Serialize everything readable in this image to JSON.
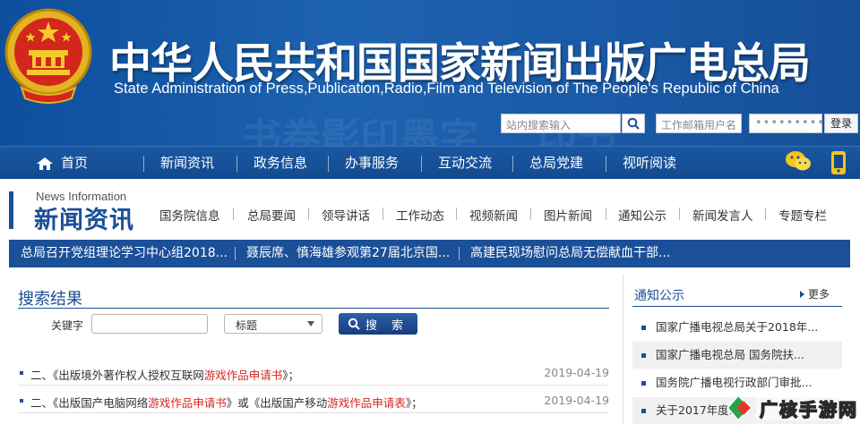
{
  "header": {
    "title_cn": "中华人民共和国国家新闻出版广电总局",
    "title_en": "State Administration of Press,Publication,Radio,Film and Television of The People's Republic of China",
    "search_placeholder": "站内搜索输入",
    "mail_placeholder": "工作邮箱用户名",
    "password_mask": "•••••••••",
    "login_label": "登录"
  },
  "main_nav": [
    {
      "label": "首页"
    },
    {
      "label": "新闻资讯"
    },
    {
      "label": "政务信息"
    },
    {
      "label": "办事服务"
    },
    {
      "label": "互动交流"
    },
    {
      "label": "总局党建"
    },
    {
      "label": "视听阅读"
    }
  ],
  "section": {
    "title_en": "News Information",
    "title_cn": "新闻资讯",
    "subnav": [
      "国务院信息",
      "总局要闻",
      "领导讲话",
      "工作动态",
      "视频新闻",
      "图片新闻",
      "通知公示",
      "新闻发言人",
      "专题专栏"
    ]
  },
  "ticker": [
    "总局召开党组理论学习中心组2018...",
    "聂辰席、慎海雄参观第27届北京国...",
    "高建民现场慰问总局无偿献血干部..."
  ],
  "search_results": {
    "title": "搜索结果",
    "keyword_label": "关键字",
    "keyword_value": "",
    "select_value": "标题",
    "search_button": "搜 索",
    "rows": [
      {
        "prefix": "二、《出版境外著作权人授权互联网",
        "highlight": "游戏作品申请书",
        "suffix": "》；",
        "date": "2019-04-19"
      },
      {
        "prefix": "二、《出版国产电脑网络",
        "highlight": "游戏作品申请书",
        "mid": "》或《出版国产移动",
        "highlight2": "游戏作品申请表",
        "suffix": "》；",
        "date": "2019-04-19"
      }
    ]
  },
  "notice_panel": {
    "title": "通知公示",
    "more": "更多",
    "items": [
      "国家广播电视总局关于2018年...",
      "国家广播电视总局 国务院扶...",
      "国务院广播电视行政部门审批...",
      "关于2017年度..."
    ]
  },
  "watermark": "广核手游网",
  "colors": {
    "brand_blue": "#1b4f98",
    "banner_blue": "#1d62b0",
    "highlight_red": "#d6261c"
  }
}
